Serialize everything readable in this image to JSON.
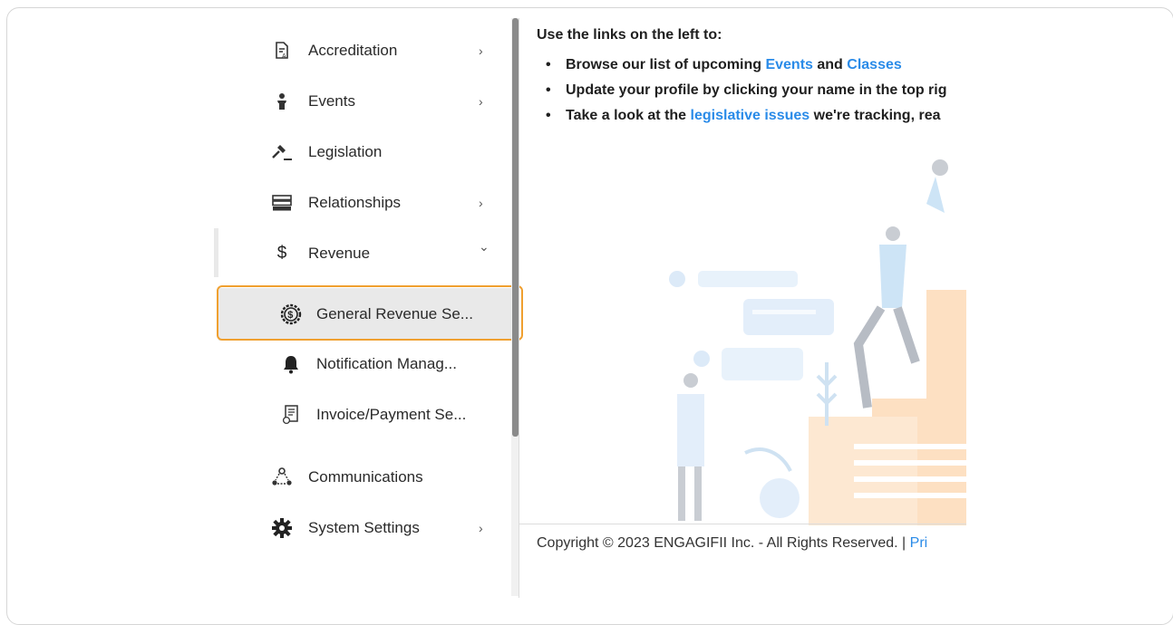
{
  "sidebar": {
    "items": [
      {
        "label": "Accreditation",
        "icon": "certificate-icon",
        "chevron": "›"
      },
      {
        "label": "Events",
        "icon": "person-podium-icon",
        "chevron": "›"
      },
      {
        "label": "Legislation",
        "icon": "gavel-icon",
        "chevron": ""
      },
      {
        "label": "Relationships",
        "icon": "server-stack-icon",
        "chevron": "›"
      },
      {
        "label": "Revenue",
        "icon": "dollar-icon",
        "chevron": "⌄"
      }
    ],
    "sub_items": [
      {
        "label": "General Revenue Se...",
        "icon": "dollar-gear-icon"
      },
      {
        "label": "Notification Manag...",
        "icon": "bell-icon"
      },
      {
        "label": "Invoice/Payment Se...",
        "icon": "invoice-icon"
      }
    ],
    "bottom_items": [
      {
        "label": "Communications",
        "icon": "network-icon",
        "chevron": ""
      },
      {
        "label": "System Settings",
        "icon": "gear-icon",
        "chevron": "›"
      }
    ]
  },
  "main": {
    "intro": "Use the links on the left to:",
    "bullet1": {
      "pre": "Browse our list of upcoming ",
      "link1": "Events",
      "mid": " and ",
      "link2": "Classes"
    },
    "bullet2": {
      "text": "Update your profile by clicking your name in the top rig"
    },
    "bullet3": {
      "pre": "Take a look at the ",
      "link": "legislative issues",
      "post": " we're tracking, rea"
    }
  },
  "footer": {
    "text": "Copyright © 2023 ENGAGIFII Inc. - All Rights Reserved. | ",
    "link": "Pri"
  },
  "colors": {
    "link": "#2a8be8",
    "highlight": "#f0a030",
    "active_bg": "#e9e9e9"
  }
}
